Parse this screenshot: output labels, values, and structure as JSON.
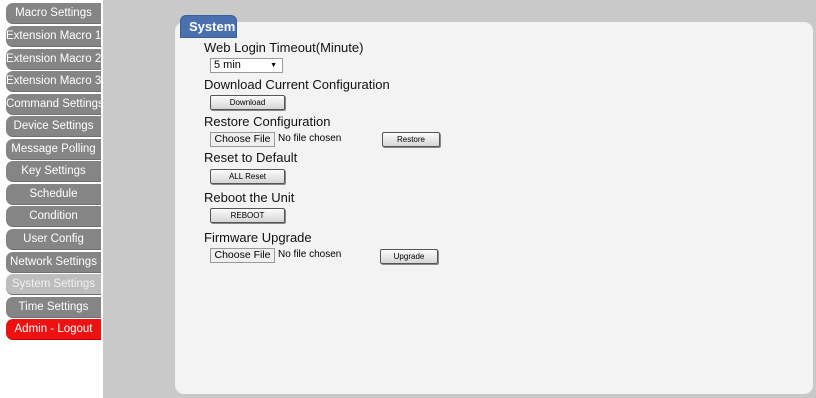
{
  "sidebar": {
    "items": [
      {
        "label": "Macro Settings"
      },
      {
        "label": "Extension Macro 1"
      },
      {
        "label": "Extension Macro 2"
      },
      {
        "label": "Extension Macro 3"
      },
      {
        "label": "Command Settings"
      },
      {
        "label": "Device Settings"
      },
      {
        "label": "Message Polling"
      },
      {
        "label": "Key Settings"
      },
      {
        "label": "Schedule"
      },
      {
        "label": "Condition"
      },
      {
        "label": "User Config"
      },
      {
        "label": "Network Settings"
      },
      {
        "label": "System Settings"
      },
      {
        "label": "Time Settings"
      },
      {
        "label": "Admin - Logout"
      }
    ],
    "active": "System Settings"
  },
  "panel": {
    "title": "System",
    "web_login_timeout": {
      "label": "Web Login Timeout(Minute)",
      "value": "5 min"
    },
    "download_config": {
      "label": "Download Current Configuration",
      "button": "Download"
    },
    "restore_config": {
      "label": "Restore Configuration",
      "choose_file": "Choose File",
      "file_status": "No file chosen",
      "button": "Restore"
    },
    "reset_default": {
      "label": "Reset to Default",
      "button": "ALL Reset"
    },
    "reboot": {
      "label": "Reboot the Unit",
      "button": "REBOOT"
    },
    "firmware": {
      "label": "Firmware Upgrade",
      "choose_file": "Choose File",
      "file_status": "No file chosen",
      "button": "Upgrade"
    }
  },
  "colors": {
    "nav_gray": "#858585",
    "nav_active": "#bdbdbd",
    "logout_red": "#ee1111",
    "tab_blue": "#4a71ae",
    "panel_bg": "#f3f3f3",
    "frame_gray": "#c9c9c9"
  }
}
